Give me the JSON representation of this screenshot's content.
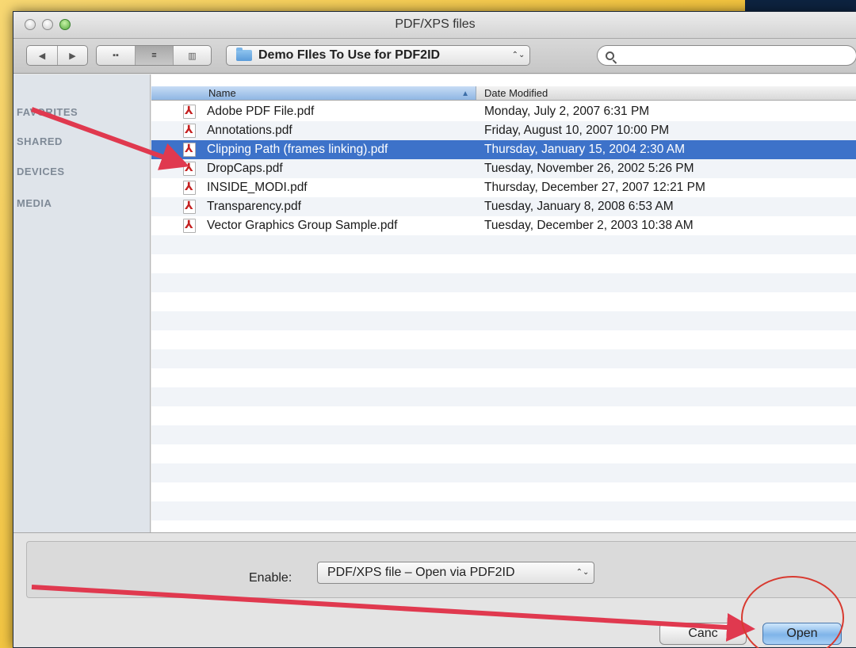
{
  "window": {
    "title": "PDF/XPS files"
  },
  "toolbar": {
    "back_icon": "◀",
    "forward_icon": "▶",
    "view_icons": [
      "▪▪",
      "≡",
      "▥"
    ],
    "location": "Demo FIles To Use for PDF2ID",
    "location_arrows": "⌃⌄",
    "search_placeholder": ""
  },
  "sidebar": {
    "items": [
      {
        "label": "FAVORITES"
      },
      {
        "label": "SHARED"
      },
      {
        "label": "DEVICES"
      },
      {
        "label": "MEDIA"
      }
    ]
  },
  "list": {
    "columns": {
      "name": "Name",
      "date": "Date Modified",
      "sort_icon": "▲"
    },
    "rows": [
      {
        "name": "Adobe PDF File.pdf",
        "date": "Monday, July 2, 2007 6:31 PM"
      },
      {
        "name": "Annotations.pdf",
        "date": "Friday, August 10, 2007 10:00 PM"
      },
      {
        "name": "Clipping Path (frames linking).pdf",
        "date": "Thursday, January 15, 2004 2:30 AM"
      },
      {
        "name": "DropCaps.pdf",
        "date": "Tuesday, November 26, 2002 5:26 PM"
      },
      {
        "name": "INSIDE_MODI.pdf",
        "date": "Thursday, December 27, 2007 12:21 PM"
      },
      {
        "name": "Transparency.pdf",
        "date": "Tuesday, January 8, 2008 6:53 AM"
      },
      {
        "name": "Vector Graphics Group Sample.pdf",
        "date": "Tuesday, December 2, 2003 10:38 AM"
      }
    ],
    "selected_index": 2
  },
  "bottom": {
    "enable_label": "Enable:",
    "enable_value": "PDF/XPS file – Open via PDF2ID",
    "enable_arrows": "⌃⌄",
    "cancel_label": "Canc",
    "open_label": "Open"
  },
  "colors": {
    "selection": "#3d72c9",
    "annotation_arrow": "#e0394f",
    "highlight_circle": "#d83a30"
  }
}
